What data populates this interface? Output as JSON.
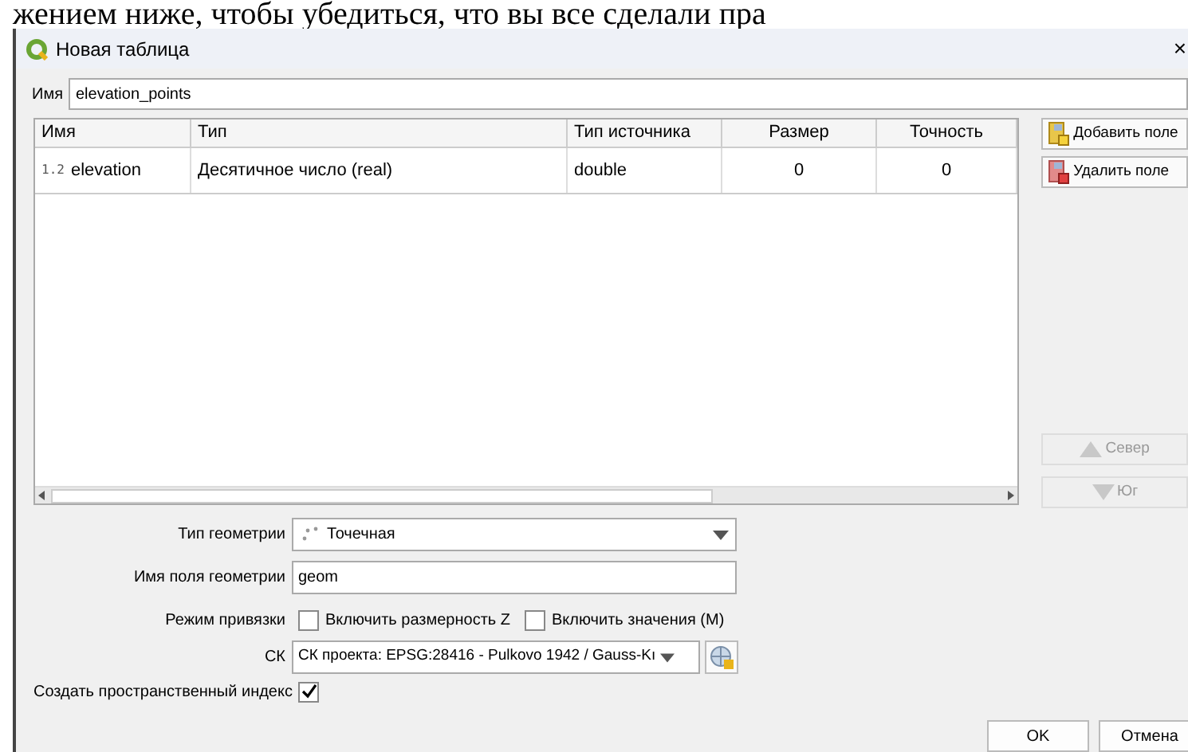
{
  "document_text": "жением ниже, чтобы убедиться, что вы все сделали пра",
  "window": {
    "title": "Новая таблица",
    "close": "×"
  },
  "name_field": {
    "label": "Имя",
    "value": "elevation_points"
  },
  "table": {
    "columns": [
      "Имя",
      "Тип",
      "Тип источника",
      "Размер",
      "Точность"
    ],
    "rows": [
      {
        "type_badge": "1.2",
        "cells": [
          "elevation",
          "Десятичное число (real)",
          "double",
          "0",
          "0"
        ],
        "selected": false
      }
    ]
  },
  "side_buttons": [
    {
      "label": "Добавить поле",
      "kind": "add",
      "disabled": false
    },
    {
      "label": "Удалить поле",
      "kind": "remove",
      "disabled": false
    },
    {
      "label": "Север",
      "kind": "up",
      "disabled": true
    },
    {
      "label": "Юг",
      "kind": "down",
      "disabled": true
    }
  ],
  "geometry_type": {
    "label": "Тип геометрии",
    "value": "Точечная"
  },
  "geometry_field": {
    "label": "Имя поля геометрии",
    "value": "geom"
  },
  "snap_mode": {
    "label": "Режим привязки",
    "options": [
      {
        "label": "Включить размерность Z",
        "checked": false
      },
      {
        "label": "Включить значения (M)",
        "checked": false
      }
    ]
  },
  "crs": {
    "label": "СК",
    "value": "СК проекта: EPSG:28416 - Pulkovo 1942 / Gauss-Kı"
  },
  "spatial_index": {
    "label": "Создать пространственный индекс",
    "checked": true
  },
  "buttons": [
    "OK",
    "Отмена"
  ]
}
